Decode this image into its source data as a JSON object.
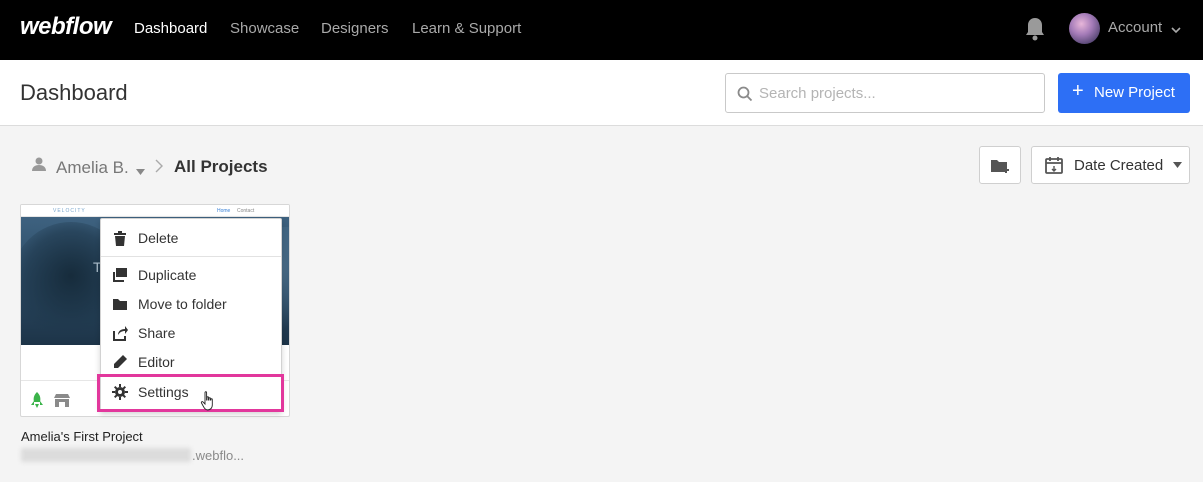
{
  "nav": {
    "logo": "webflow",
    "links": [
      "Dashboard",
      "Showcase",
      "Designers",
      "Learn & Support"
    ],
    "account": "Account"
  },
  "header": {
    "title": "Dashboard",
    "search_placeholder": "Search projects...",
    "new_project": "New Project"
  },
  "breadcrumb": {
    "user": "Amelia B.",
    "current": "All Projects"
  },
  "sort": {
    "label": "Date Created"
  },
  "project": {
    "thumbnail": {
      "brand": "VELOCITY",
      "links": [
        "Home",
        "Contact"
      ],
      "hero_text": "T"
    },
    "name": "Amelia's First Project",
    "url_suffix": ".webflo..."
  },
  "context_menu": {
    "items": [
      {
        "label": "Delete",
        "icon": "trash-icon"
      },
      {
        "label": "Duplicate",
        "icon": "duplicate-icon"
      },
      {
        "label": "Move to folder",
        "icon": "folder-icon"
      },
      {
        "label": "Share",
        "icon": "share-icon"
      },
      {
        "label": "Editor",
        "icon": "pencil-icon"
      },
      {
        "label": "Settings",
        "icon": "gear-icon"
      }
    ],
    "highlighted": "Settings"
  },
  "colors": {
    "topbar": "#000000",
    "primary_button": "#2d6ff5",
    "highlight_border": "#e2379c",
    "publish_icon": "#3bb34a"
  }
}
